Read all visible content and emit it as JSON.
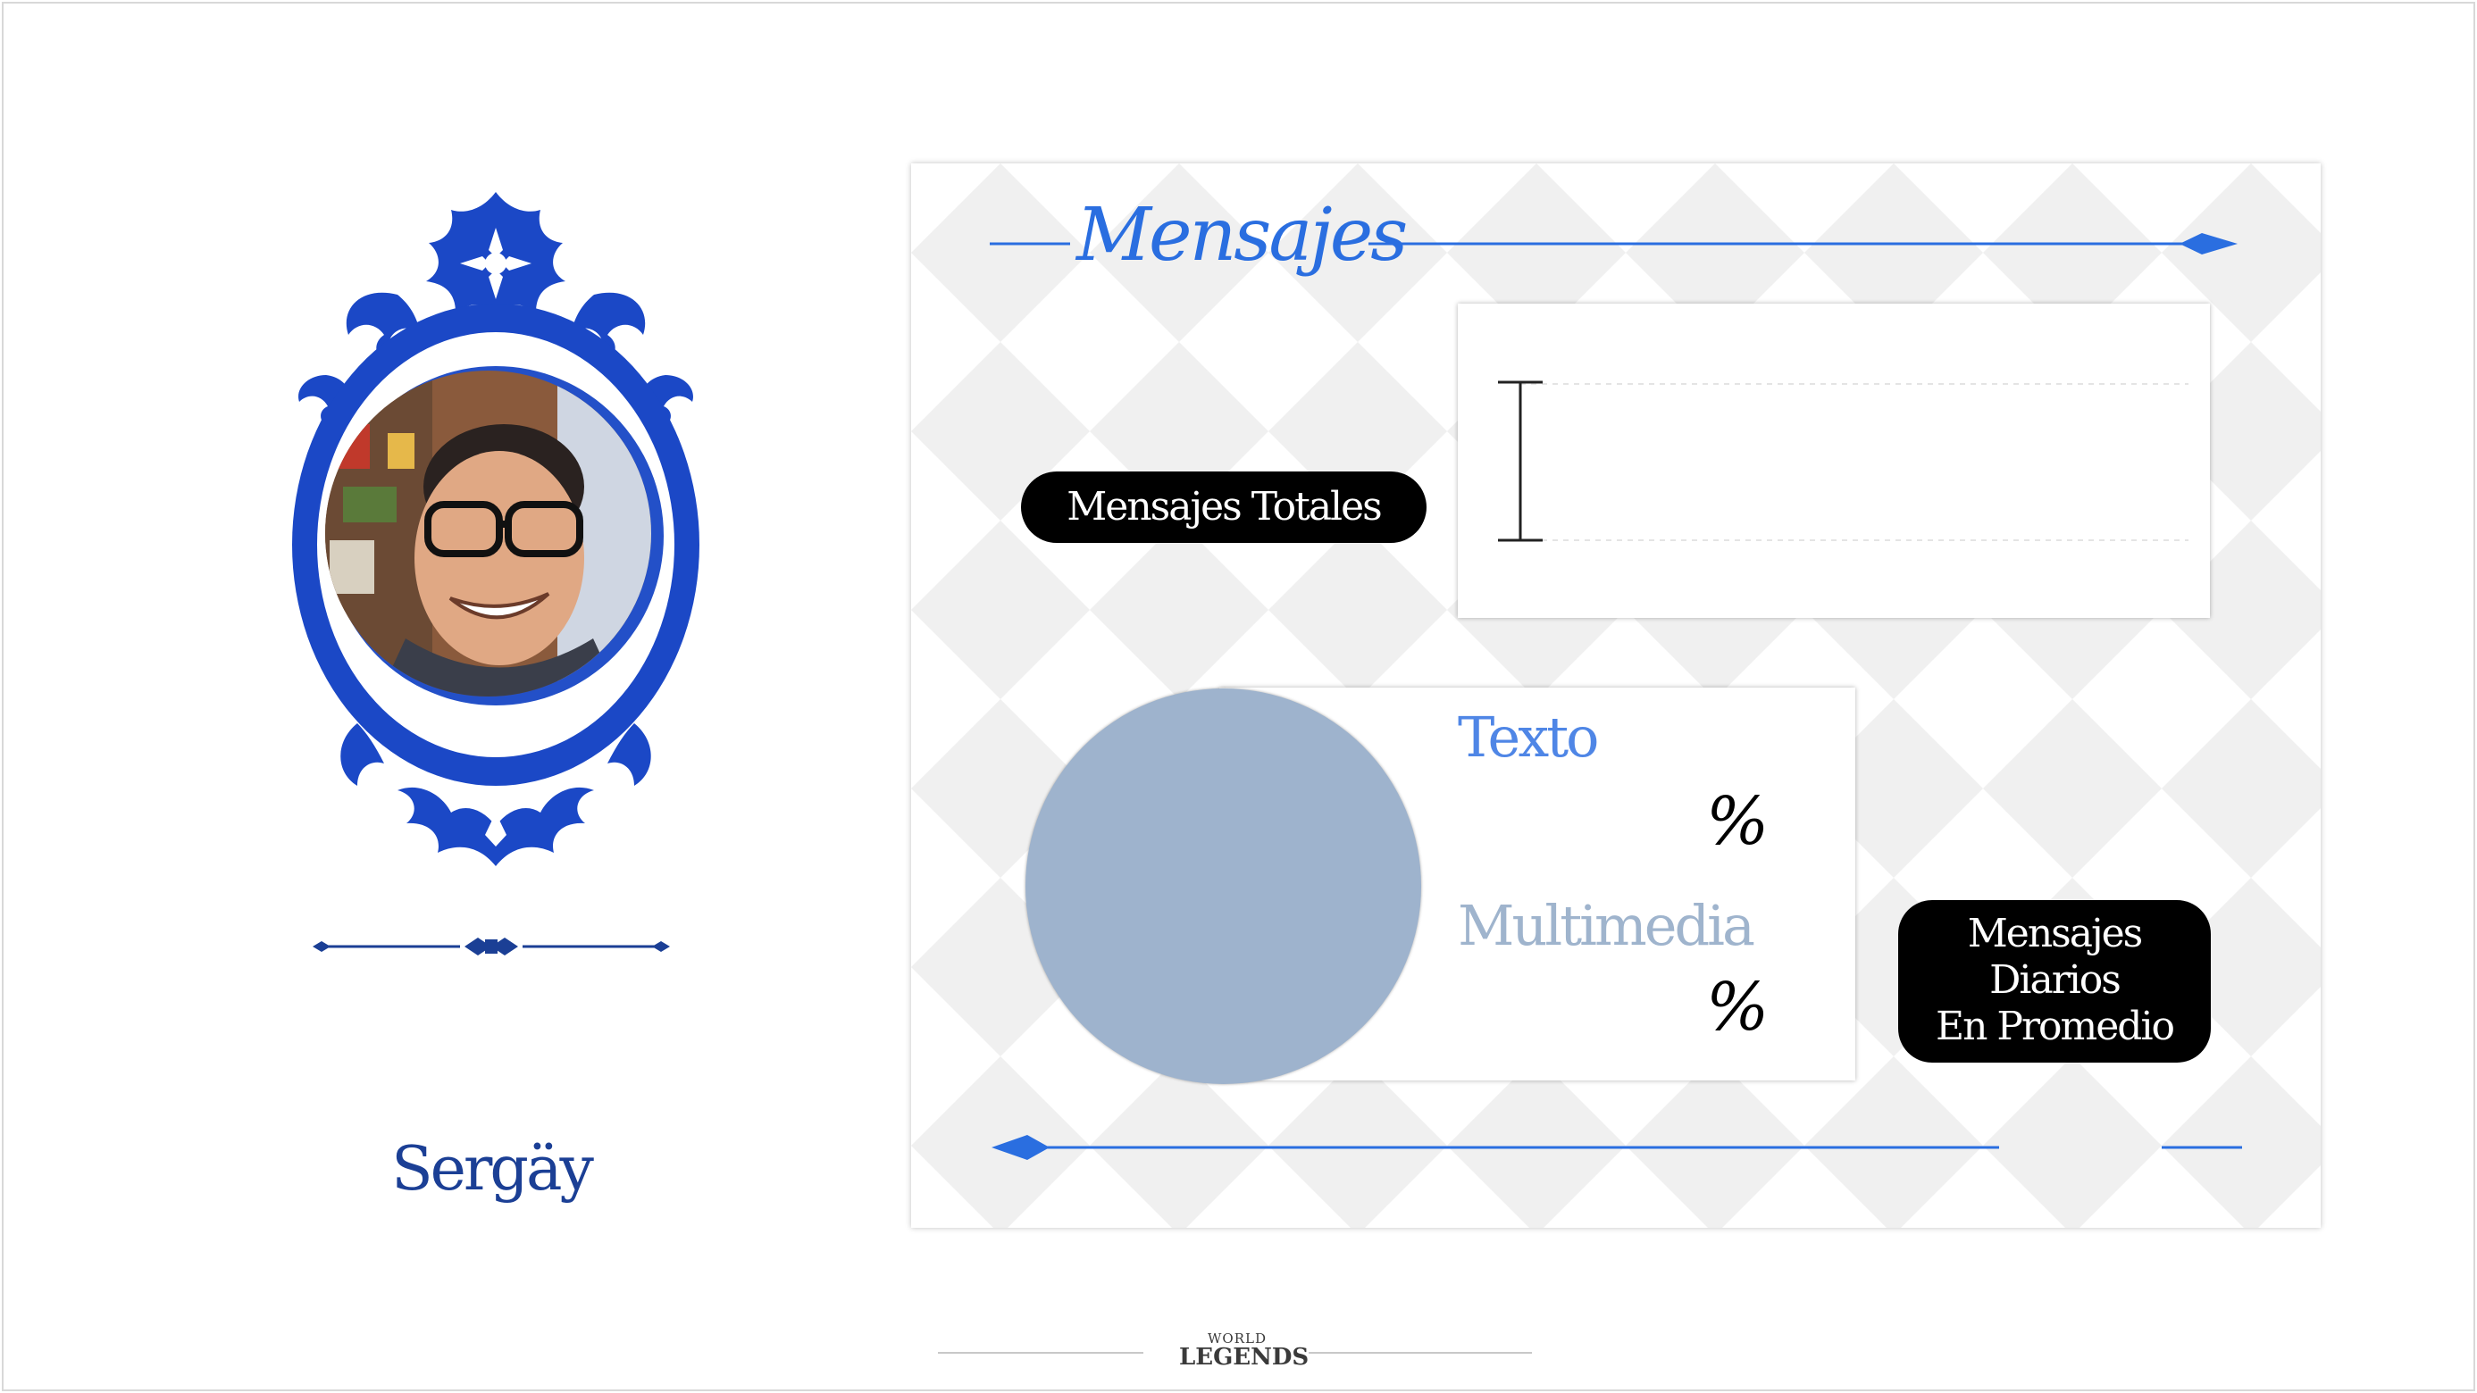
{
  "profile": {
    "username": "Sergäy"
  },
  "card": {
    "title": "Mensajes",
    "totales_label": "Mensajes Totales",
    "diarios_lines": [
      "Mensajes",
      "Diarios",
      "En Promedio"
    ],
    "texto_label": "Texto",
    "multimedia_label": "Multimedia",
    "texto_pct": "%",
    "multimedia_pct": "%"
  },
  "footer": {
    "logo_top": "WORLD",
    "logo_bottom": "LEGENDS"
  },
  "colors": {
    "brand_blue": "#1b3f95",
    "accent_blue": "#2a6ee0",
    "pie_fill": "#9eb3cd"
  }
}
